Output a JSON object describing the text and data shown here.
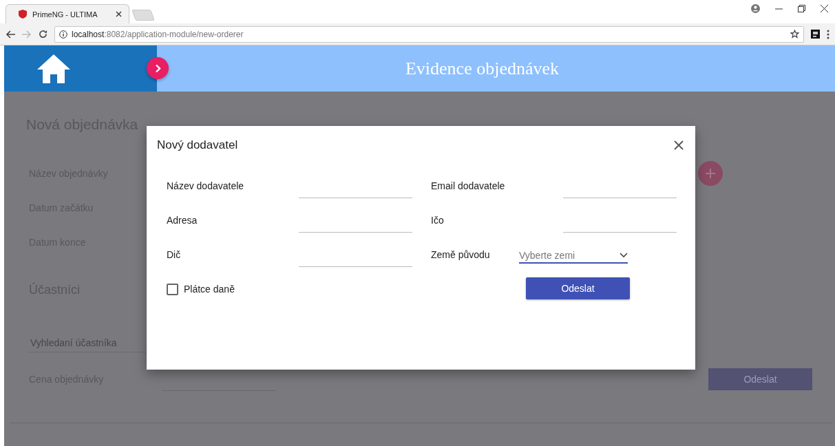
{
  "browser": {
    "tab": {
      "title": "PrimeNG - ULTIMA"
    },
    "url": {
      "host": "localhost",
      "path": ":8082/application-module/new-orderer"
    }
  },
  "header": {
    "title": "Evidence objednávek"
  },
  "page": {
    "title": "Nová objednávka",
    "fields": [
      {
        "label": "Název objednávky"
      },
      {
        "label": "Datum začátku"
      },
      {
        "label": "Datum konce"
      }
    ],
    "participants": {
      "title": "Účastníci",
      "search": {
        "placeholder": "Vyhledaní účastníka"
      }
    },
    "price": {
      "label": "Cena objednávky"
    },
    "submit": "Odeslat"
  },
  "dialog": {
    "title": "Nový dodavatel",
    "left_fields": [
      {
        "kind": "input",
        "label": "Název dodavatele"
      },
      {
        "kind": "input",
        "label": "Adresa"
      },
      {
        "kind": "input",
        "label": "Dič"
      }
    ],
    "right_fields": [
      {
        "kind": "input",
        "label": "Email dodavatele"
      },
      {
        "kind": "input",
        "label": "Ičo"
      },
      {
        "kind": "select",
        "label": "Země původu",
        "placeholder": "Vyberte zemi"
      }
    ],
    "checkbox": {
      "label": "Plátce daně",
      "checked": false
    },
    "submit": "Odeslat"
  }
}
